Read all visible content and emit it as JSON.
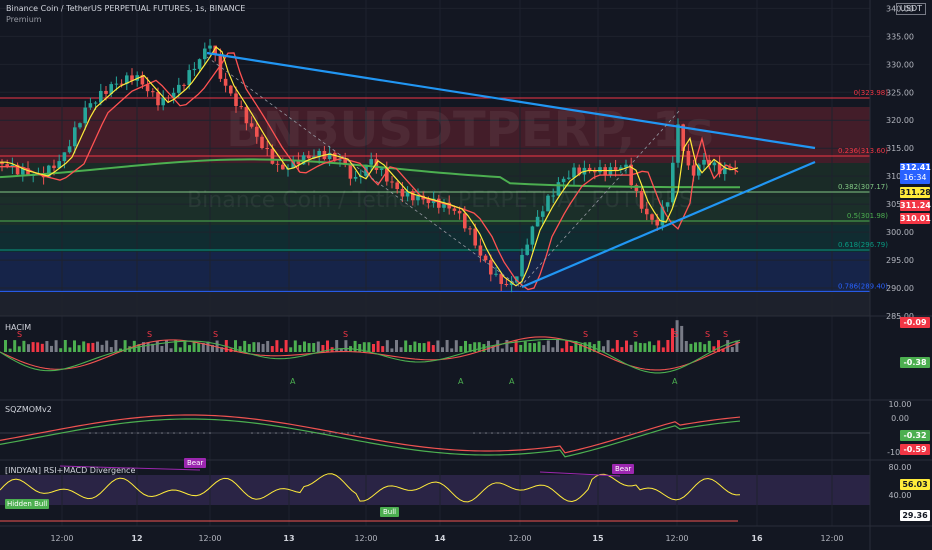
{
  "header": {
    "symbol_line": "Binance Coin / TetherUS PERPETUAL FUTURES, 1s, BINANCE",
    "sub_line": "Premium",
    "currency": "USDT"
  },
  "watermark": {
    "ticker": "BNBUSDTPERP, 1s",
    "name": "Binance Coin / TetherUS PERPETUAL FUTURES"
  },
  "main_axis": {
    "ticks": [
      "340.00",
      "335.00",
      "330.00",
      "325.00",
      "320.00",
      "315.00",
      "310.00",
      "305.00",
      "300.00",
      "295.00",
      "290.00",
      "285.00"
    ],
    "tick_values": [
      340,
      335,
      330,
      325,
      320,
      315,
      310,
      305,
      300,
      295,
      290,
      285
    ],
    "ylim": [
      285,
      341.5
    ]
  },
  "fib_levels": [
    {
      "label": "0(323.98)",
      "value": 323.98,
      "color": "#f23645"
    },
    {
      "label": "0.236(313.60)",
      "value": 313.6,
      "color": "#f23645"
    },
    {
      "label": "0.382(307.17)",
      "value": 307.17,
      "color": "#81c784"
    },
    {
      "label": "0.5(301.98)",
      "value": 301.98,
      "color": "#4caf50"
    },
    {
      "label": "0.618(296.79)",
      "value": 296.79,
      "color": "#089981"
    },
    {
      "label": "0.786(289.40)",
      "value": 289.4,
      "color": "#2962ff"
    }
  ],
  "price_tags": [
    {
      "text": "312.41",
      "sub": "16:34",
      "value": 312.41,
      "bg": "#2962ff",
      "fg": "#ffffff"
    },
    {
      "text": "311.28",
      "value": 311.28,
      "bg": "#ffeb3b",
      "fg": "#131722"
    },
    {
      "text": "311.24",
      "value": 311.24,
      "bg": "#f23645",
      "fg": "#ffffff"
    },
    {
      "text": "310.01",
      "value": 310.01,
      "bg": "#f23645",
      "fg": "#ffffff"
    }
  ],
  "panes": {
    "hacim": {
      "label": "HACIM",
      "value_top": "-0.09",
      "value_bottom": "-0.38",
      "signals_s": [
        "S",
        "S",
        "S",
        "S",
        "S",
        "S",
        "S",
        "S",
        "S"
      ],
      "signals_a": [
        "A",
        "A",
        "A",
        "A"
      ]
    },
    "sqzmom": {
      "label": "SQZMOMv2",
      "ticks": [
        "10.00",
        "0.00",
        "-10.00"
      ],
      "values": [
        "-0.32",
        "-0.59"
      ]
    },
    "rsi": {
      "label": "[INDYAN] RSI+MACD Divergence",
      "ticks": [
        "80.00",
        "40.00"
      ],
      "value_rsi": "56.03",
      "value_low": "29.36",
      "tags": [
        "Bear",
        "Bear",
        "Hidden Bull",
        "Bull"
      ]
    }
  },
  "time_axis": {
    "labels": [
      "12:00",
      "12",
      "12:00",
      "13",
      "12:00",
      "14",
      "12:00",
      "15",
      "12:00",
      "16",
      "12:00"
    ]
  },
  "colors": {
    "up": "#26a69a",
    "down": "#ef5350",
    "trendline": "#2196f3",
    "ma_yellow": "#ffeb3b",
    "ma_red": "#ff5252",
    "ma_green": "#4caf50"
  }
}
